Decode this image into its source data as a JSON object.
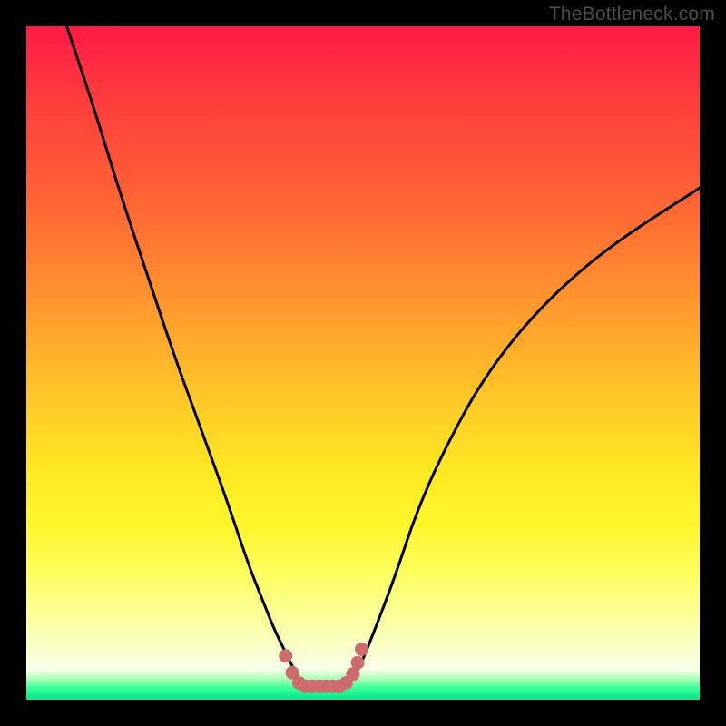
{
  "watermark": "TheBottleneck.com",
  "chart_data": {
    "type": "line",
    "title": "",
    "xlabel": "",
    "ylabel": "",
    "xlim": [
      0,
      100
    ],
    "ylim": [
      0,
      100
    ],
    "series": [
      {
        "name": "bottleneck-curve",
        "color": "#000000",
        "x": [
          6,
          10,
          14,
          18,
          22,
          26,
          30,
          33,
          35,
          37,
          39,
          40,
          41,
          42,
          43,
          45,
          47,
          49,
          50,
          52,
          55,
          58,
          62,
          68,
          76,
          86,
          100
        ],
        "values": [
          100,
          88,
          75,
          63,
          51,
          40,
          29,
          20,
          15,
          10,
          6,
          4,
          2.5,
          2,
          2,
          2,
          2,
          4,
          6,
          11,
          19,
          28,
          37,
          48,
          58,
          67,
          76
        ]
      },
      {
        "name": "minimum-marker",
        "type": "scatter",
        "color": "#cc6b6e",
        "x": [
          38.5,
          39.5,
          40.5,
          41.5,
          42.5,
          43.5,
          44.5,
          45.5,
          46.5,
          47.5,
          48.5,
          49.2,
          49.8
        ],
        "values": [
          6.5,
          4.0,
          2.5,
          2.0,
          2.0,
          2.0,
          2.0,
          2.0,
          2.0,
          2.5,
          3.8,
          5.5,
          7.5
        ]
      }
    ]
  }
}
